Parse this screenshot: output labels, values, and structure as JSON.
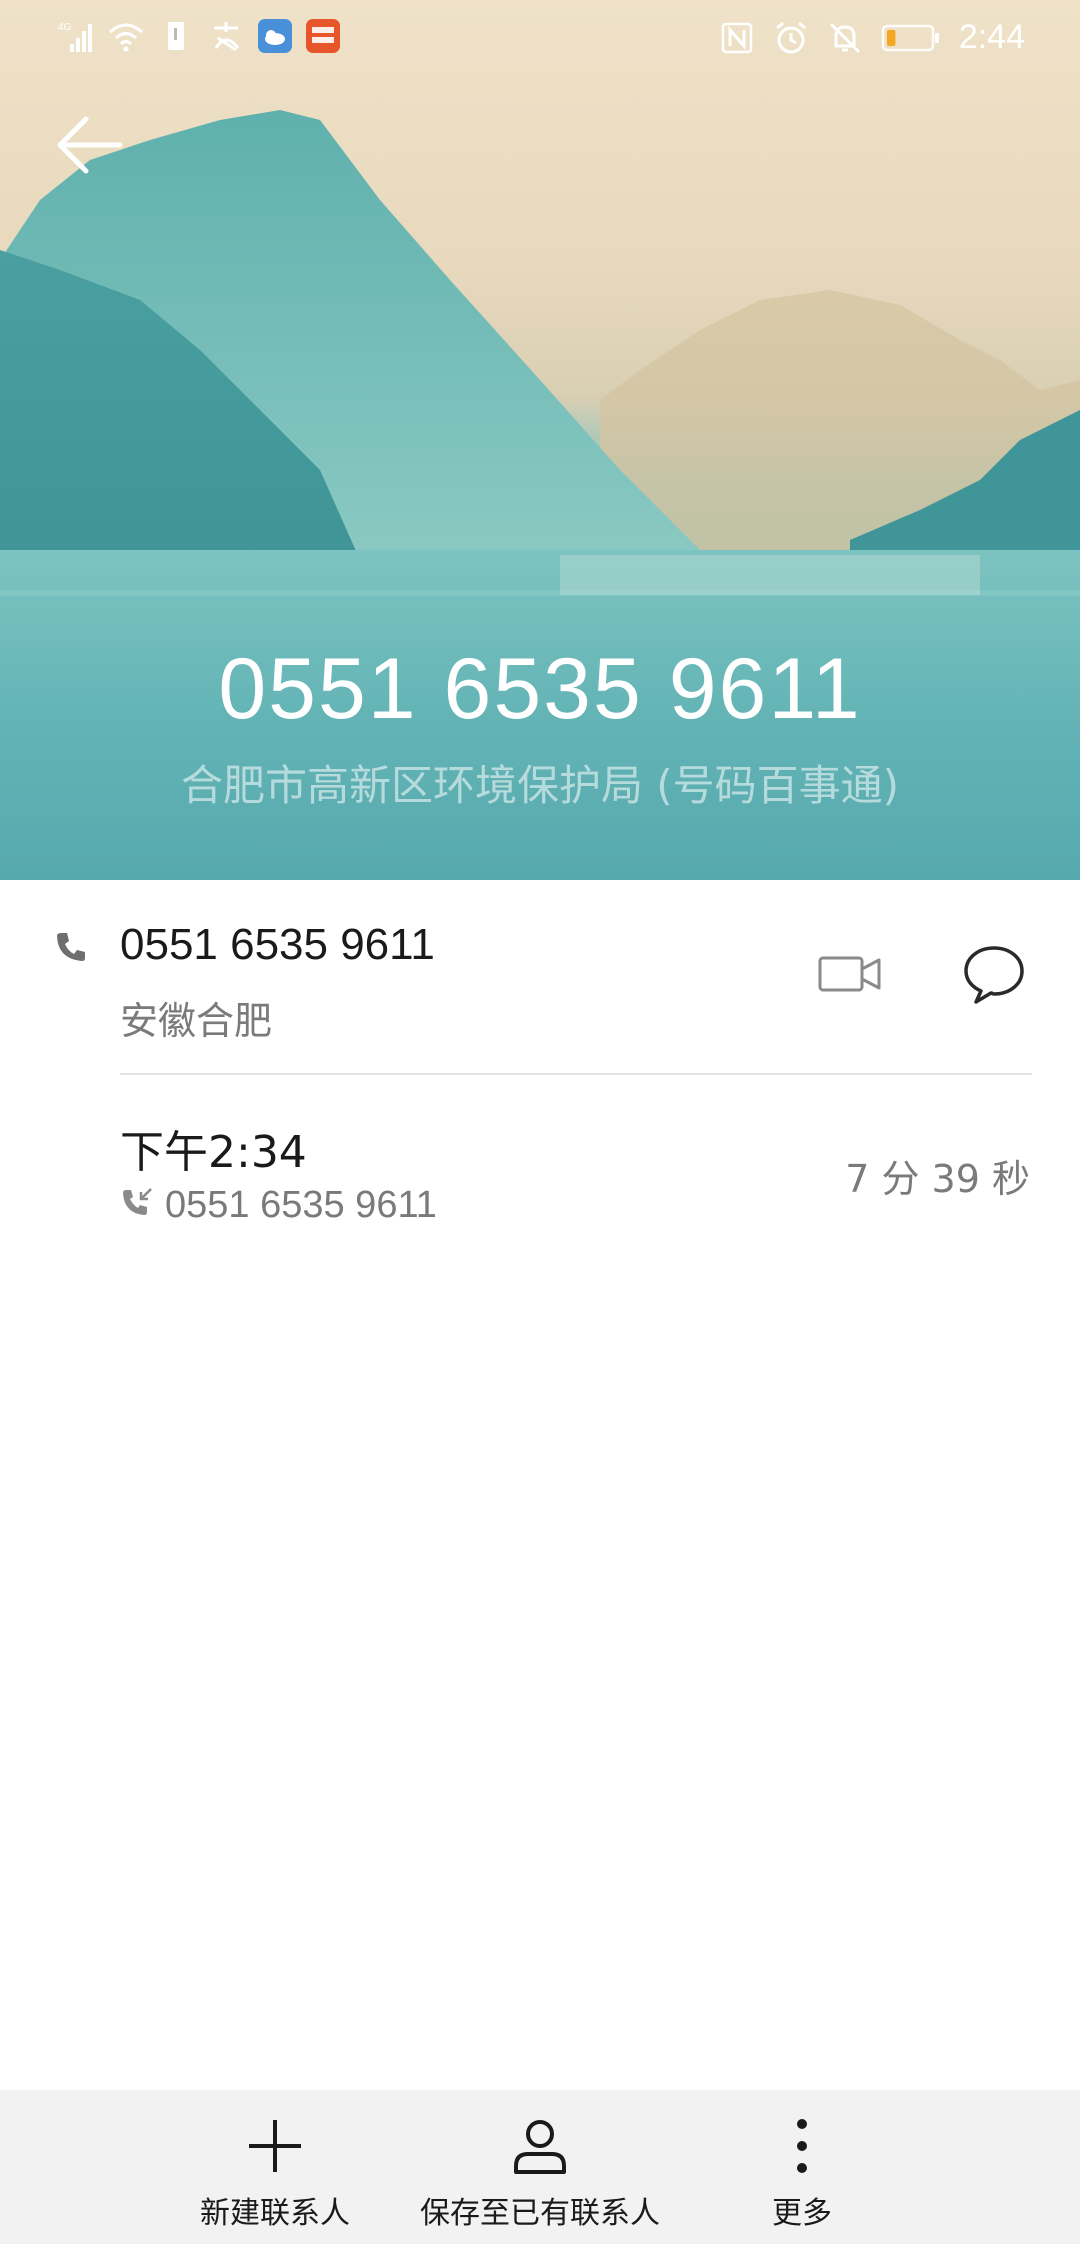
{
  "status_bar": {
    "network": "4G",
    "time": "2:44",
    "left_icons": [
      "signal-icon",
      "wifi-icon",
      "sim-icon",
      "alipay-icon",
      "weather-app-icon",
      "pingan-bank-icon"
    ],
    "right_icons": [
      "nfc-icon",
      "alarm-icon",
      "mute-icon",
      "battery-icon"
    ],
    "battery_level": 0.2
  },
  "header": {
    "phone_number": "0551 6535 9611",
    "caller_name": "合肥市高新区环境保护局 (号码百事通)"
  },
  "number_row": {
    "number": "0551 6535 9611",
    "location": "安徽合肥"
  },
  "call_log": {
    "time": "下午2:34",
    "number": "0551 6535 9611",
    "duration": "7 分 39 秒"
  },
  "bottom_bar": {
    "new_contact": "新建联系人",
    "save_existing": "保存至已有联系人",
    "more": "更多"
  },
  "colors": {
    "accent_text": "#1a1a1a",
    "secondary_text": "#7a7a7a",
    "battery_fill": "#f5a623"
  }
}
